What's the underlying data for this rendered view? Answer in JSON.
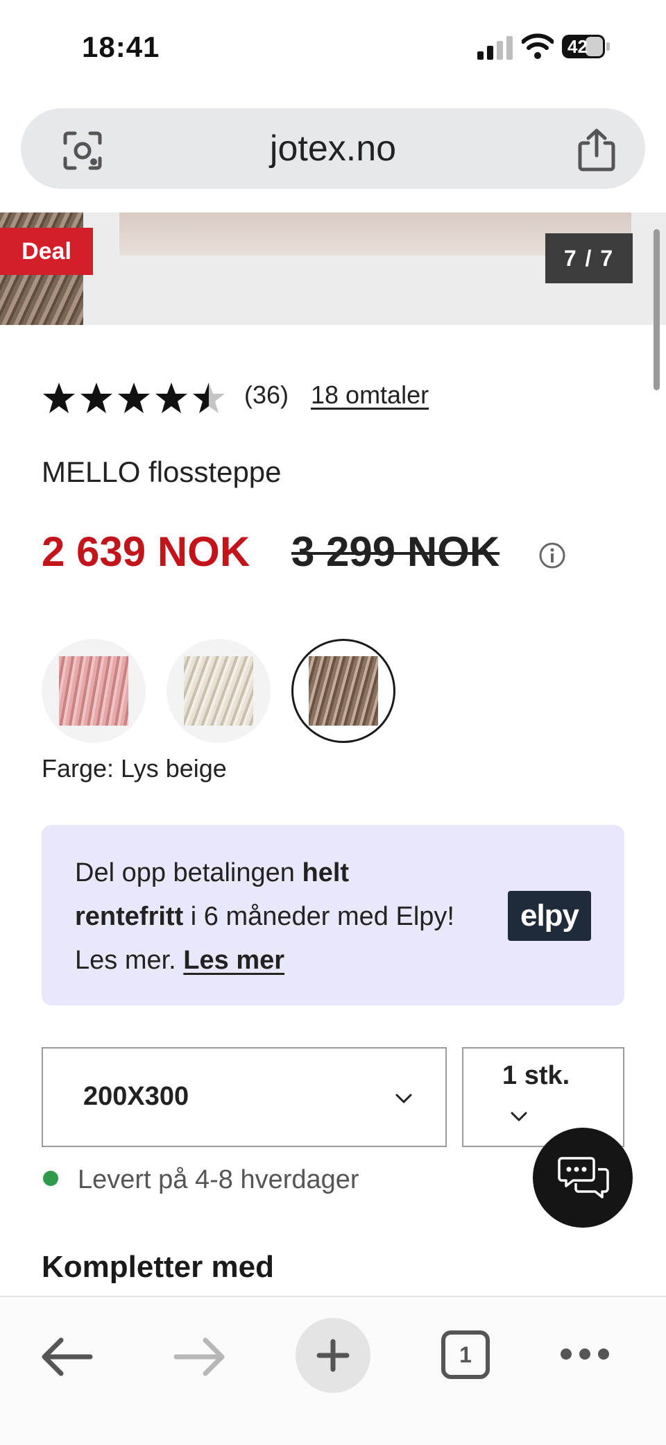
{
  "status_bar": {
    "time": "18:41",
    "battery": "42"
  },
  "browser": {
    "url": "jotex.no"
  },
  "gallery": {
    "deal_label": "Deal",
    "counter": "7 / 7"
  },
  "product": {
    "rating": 4.5,
    "rating_count": "(36)",
    "reviews_link": "18 omtaler",
    "title": "MELLO flossteppe",
    "price_now": "2 639 NOK",
    "price_old": "3 299 NOK",
    "color_label": "Farge: Lys beige",
    "swatches": [
      "pink",
      "cream",
      "light-beige"
    ],
    "selected_swatch": 2
  },
  "elpy": {
    "text_1": "Del opp betalingen ",
    "bold_1": "helt rentefritt",
    "text_2": " i 6 måneder med Elpy! Les mer. ",
    "link": "Les mer",
    "logo": "elpy"
  },
  "selectors": {
    "size": "200X300",
    "quantity": "1 stk."
  },
  "delivery": {
    "text": "Levert på 4-8 hverdager",
    "status_color": "#2f9a4b"
  },
  "section": {
    "title": "Kompletter med"
  },
  "toolbar": {
    "tab_count": "1"
  },
  "colors": {
    "sale_red": "#c3141b",
    "deal_red": "#d21f2a",
    "elpy_bg": "#e9e8fb",
    "elpy_logo_bg": "#1f2a3a"
  }
}
